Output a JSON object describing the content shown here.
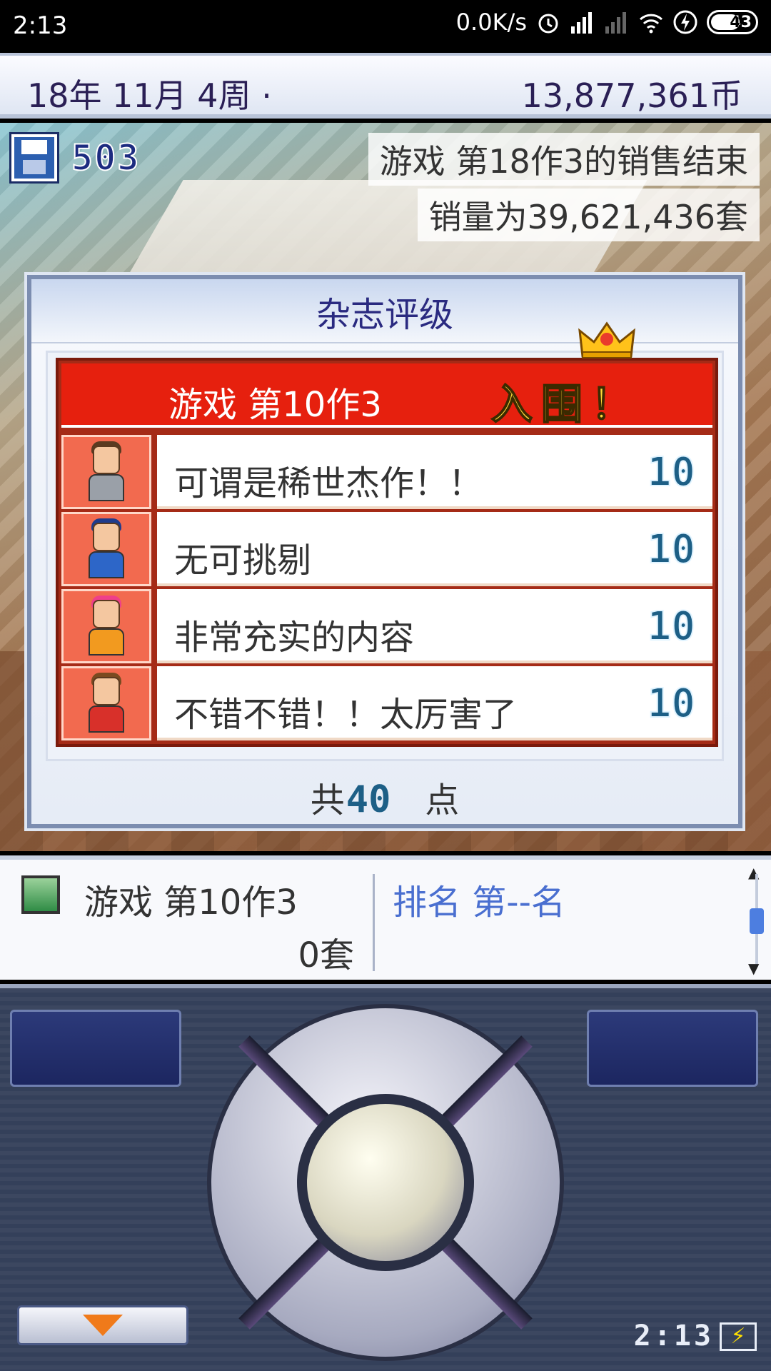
{
  "status_bar": {
    "time": "2:13",
    "net_speed": "0.0K/s",
    "battery_level": "43"
  },
  "top_bar": {
    "date": "18年 11月 4周 ·",
    "money": "13,877,361币"
  },
  "scene": {
    "save_count": "503",
    "notice_line1": "游戏 第18作3的销售结束",
    "notice_line2": "销量为39,621,436套"
  },
  "dialog": {
    "title": "杂志评级",
    "game_name": "游戏 第10作3",
    "badge": "入围！",
    "reviews": [
      {
        "comment": "可谓是稀世杰作！！",
        "score": "10"
      },
      {
        "comment": "无可挑剔",
        "score": "10"
      },
      {
        "comment": "非常充实的内容",
        "score": "10"
      },
      {
        "comment": "不错不错！！太厉害了",
        "score": "10"
      }
    ],
    "total_prefix": "共",
    "total_value": "40",
    "total_suffix": "点"
  },
  "info_bar": {
    "game_name": "游戏 第10作3",
    "sales": "0套",
    "rank": "排名 第--名"
  },
  "controller": {
    "clock": "2:13"
  },
  "colors": {
    "accent_red": "#e6200e",
    "score_blue": "#1d5f86",
    "rank_blue": "#4a6fd0"
  }
}
